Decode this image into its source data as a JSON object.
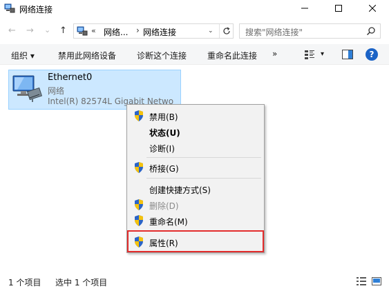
{
  "window": {
    "title": "网络连接",
    "controls": {
      "minimize": "minimize-icon",
      "maximize": "maximize-icon",
      "close": "close-icon"
    }
  },
  "nav": {
    "back_icon": "←",
    "forward_icon": "→",
    "recent_icon": "⌄",
    "up_icon": "↑",
    "address": {
      "overflow": "«",
      "segment1": "网络...",
      "separator": "›",
      "segment2": "网络连接",
      "dropdown": "⌄"
    },
    "search_placeholder": "搜索\"网络连接\""
  },
  "toolbar": {
    "organize": "组织 ▾",
    "disable_device": "禁用此网络设备",
    "diagnose": "诊断这个连接",
    "rename": "重命名此连接",
    "more": "»",
    "view_dropdown": "▾",
    "help": "?"
  },
  "connection": {
    "name": "Ethernet0",
    "type": "网络",
    "device": "Intel(R) 82574L Gigabit Netwo"
  },
  "context_menu": {
    "items": [
      {
        "label": "禁用(B)",
        "shield": true,
        "bold": false,
        "disabled": false
      },
      {
        "label": "状态(U)",
        "shield": false,
        "bold": true,
        "disabled": false
      },
      {
        "label": "诊断(I)",
        "shield": false,
        "bold": false,
        "disabled": false
      },
      {
        "label": "桥接(G)",
        "shield": true,
        "bold": false,
        "disabled": false
      },
      {
        "label": "创建快捷方式(S)",
        "shield": false,
        "bold": false,
        "disabled": false
      },
      {
        "label": "删除(D)",
        "shield": true,
        "bold": false,
        "disabled": true
      },
      {
        "label": "重命名(M)",
        "shield": true,
        "bold": false,
        "disabled": false
      },
      {
        "label": "属性(R)",
        "shield": true,
        "bold": false,
        "disabled": false
      }
    ]
  },
  "status": {
    "item_count": "1 个项目",
    "selected_count": "选中 1 个项目"
  },
  "colors": {
    "selection_bg": "#cce8ff",
    "selection_border": "#99d1ff",
    "highlight_box": "#e32c2c",
    "help_blue": "#1b63c6"
  }
}
